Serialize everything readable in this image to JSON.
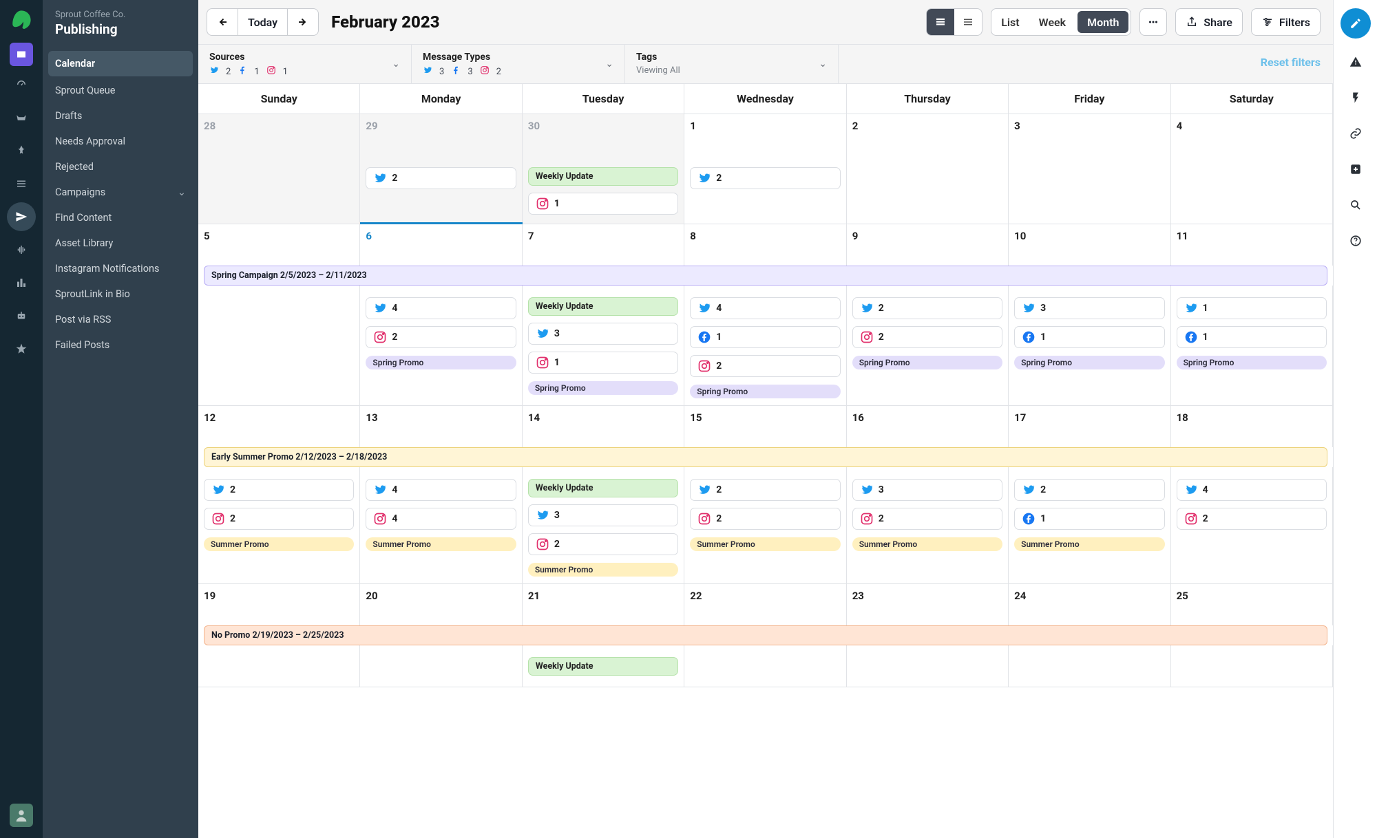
{
  "org": {
    "name": "Sprout Coffee Co.",
    "section": "Publishing"
  },
  "nav": {
    "items": [
      {
        "label": "Calendar",
        "selected": true
      },
      {
        "label": "Sprout Queue"
      },
      {
        "label": "Drafts"
      },
      {
        "label": "Needs Approval"
      },
      {
        "label": "Rejected"
      },
      {
        "label": "Campaigns",
        "expandable": true
      },
      {
        "label": "Find Content"
      },
      {
        "label": "Asset Library"
      },
      {
        "label": "Instagram Notifications"
      },
      {
        "label": "SproutLink in Bio"
      },
      {
        "label": "Post via RSS"
      },
      {
        "label": "Failed Posts"
      }
    ]
  },
  "toolbar": {
    "today": "Today",
    "title": "February 2023",
    "views": {
      "list": "List",
      "week": "Week",
      "month": "Month"
    },
    "share": "Share",
    "filters": "Filters"
  },
  "filters": {
    "sources": {
      "label": "Sources",
      "tw": "2",
      "fb": "1",
      "ig": "1"
    },
    "types": {
      "label": "Message Types",
      "tw": "3",
      "fb": "3",
      "ig": "2"
    },
    "tags": {
      "label": "Tags",
      "sub": "Viewing All"
    },
    "reset": "Reset filters"
  },
  "dow": [
    "Sunday",
    "Monday",
    "Tuesday",
    "Wednesday",
    "Thursday",
    "Friday",
    "Saturday"
  ],
  "weeks": [
    {
      "banner": null,
      "days": [
        {
          "n": "28",
          "muted": true,
          "other": true
        },
        {
          "n": "29",
          "muted": true,
          "other": true,
          "pills": [
            {
              "t": "tw",
              "c": "2"
            }
          ]
        },
        {
          "n": "30",
          "muted": true,
          "other": true,
          "green": "Weekly Update",
          "pills": [
            {
              "t": "ig",
              "c": "1"
            }
          ]
        },
        {
          "n": "1",
          "pills": [
            {
              "t": "tw",
              "c": "2"
            }
          ]
        },
        {
          "n": "2"
        },
        {
          "n": "3"
        },
        {
          "n": "4"
        }
      ]
    },
    {
      "banner": {
        "cls": "purple",
        "text": "Spring Campaign 2/5/2023 – 2/11/2023"
      },
      "todayCol": 1,
      "days": [
        {
          "n": "5"
        },
        {
          "n": "6",
          "today": true,
          "pills": [
            {
              "t": "tw",
              "c": "4"
            },
            {
              "t": "ig",
              "c": "2"
            }
          ],
          "tag": "Spring Promo"
        },
        {
          "n": "7",
          "green": "Weekly Update",
          "pills": [
            {
              "t": "tw",
              "c": "3"
            },
            {
              "t": "ig",
              "c": "1"
            }
          ],
          "tag": "Spring Promo"
        },
        {
          "n": "8",
          "pills": [
            {
              "t": "tw",
              "c": "4"
            },
            {
              "t": "fb",
              "c": "1"
            },
            {
              "t": "ig",
              "c": "2"
            }
          ],
          "tag": "Spring Promo"
        },
        {
          "n": "9",
          "pills": [
            {
              "t": "tw",
              "c": "2"
            },
            {
              "t": "ig",
              "c": "2"
            }
          ],
          "tag": "Spring Promo"
        },
        {
          "n": "10",
          "pills": [
            {
              "t": "tw",
              "c": "3"
            },
            {
              "t": "fb",
              "c": "1"
            }
          ],
          "tag": "Spring Promo"
        },
        {
          "n": "11",
          "pills": [
            {
              "t": "tw",
              "c": "1"
            },
            {
              "t": "fb",
              "c": "1"
            }
          ],
          "tag": "Spring Promo"
        }
      ]
    },
    {
      "banner": {
        "cls": "yellow",
        "text": "Early Summer Promo 2/12/2023 – 2/18/2023"
      },
      "days": [
        {
          "n": "12",
          "pills": [
            {
              "t": "tw",
              "c": "2"
            },
            {
              "t": "ig",
              "c": "2"
            }
          ],
          "tag": "Summer Promo",
          "tagcls": "yel"
        },
        {
          "n": "13",
          "pills": [
            {
              "t": "tw",
              "c": "4"
            },
            {
              "t": "ig",
              "c": "4"
            }
          ],
          "tag": "Summer Promo",
          "tagcls": "yel"
        },
        {
          "n": "14",
          "green": "Weekly Update",
          "pills": [
            {
              "t": "tw",
              "c": "3"
            },
            {
              "t": "ig",
              "c": "2"
            }
          ],
          "tag": "Summer Promo",
          "tagcls": "yel"
        },
        {
          "n": "15",
          "pills": [
            {
              "t": "tw",
              "c": "2"
            },
            {
              "t": "ig",
              "c": "2"
            }
          ],
          "tag": "Summer Promo",
          "tagcls": "yel"
        },
        {
          "n": "16",
          "pills": [
            {
              "t": "tw",
              "c": "3"
            },
            {
              "t": "ig",
              "c": "2"
            }
          ],
          "tag": "Summer Promo",
          "tagcls": "yel"
        },
        {
          "n": "17",
          "pills": [
            {
              "t": "tw",
              "c": "2"
            },
            {
              "t": "fb",
              "c": "1"
            }
          ],
          "tag": "Summer Promo",
          "tagcls": "yel"
        },
        {
          "n": "18",
          "pills": [
            {
              "t": "tw",
              "c": "4"
            },
            {
              "t": "ig",
              "c": "2"
            }
          ]
        }
      ]
    },
    {
      "banner": {
        "cls": "orange",
        "text": "No Promo 2/19/2023 – 2/25/2023"
      },
      "days": [
        {
          "n": "19"
        },
        {
          "n": "20"
        },
        {
          "n": "21",
          "green": "Weekly Update"
        },
        {
          "n": "22"
        },
        {
          "n": "23"
        },
        {
          "n": "24"
        },
        {
          "n": "25"
        }
      ]
    }
  ]
}
